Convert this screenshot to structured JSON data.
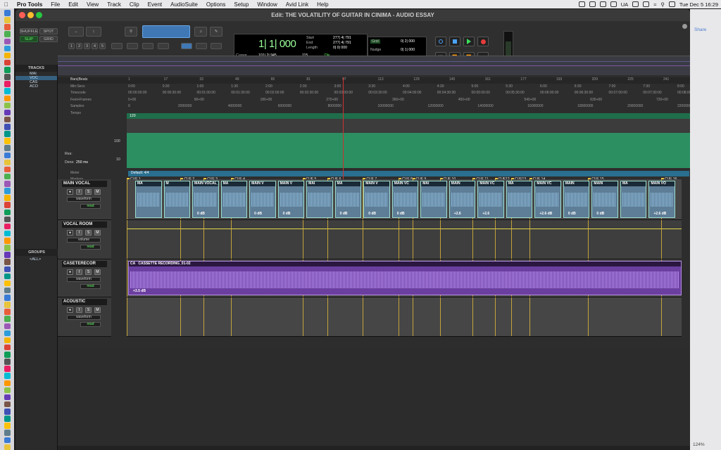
{
  "menubar": {
    "app": "Pro Tools",
    "items": [
      "File",
      "Edit",
      "View",
      "Track",
      "Clip",
      "Event",
      "AudioSuite",
      "Options",
      "Setup",
      "Window",
      "Avid Link",
      "Help"
    ],
    "right": {
      "lang": "UA",
      "datetime": "Tue Dec 5  16:29"
    }
  },
  "window": {
    "title": "Edit: THE VOLATILITY OF GUITAR IN CINIMA - AUDIO ESSAY"
  },
  "toolbar": {
    "modes": {
      "shuffle": "SHUFFLE",
      "spot": "SPOT",
      "slip": "SLIP",
      "grid": "GRID"
    },
    "zoom_presets": [
      "1",
      "2",
      "3",
      "4",
      "5"
    ],
    "counter": {
      "main": "1| 1| 000",
      "start_label": "Start",
      "end_label": "End",
      "length_label": "Length",
      "start": "277| 4| 791",
      "end": "277| 4| 791",
      "length": "0| 0| 000",
      "cursor_label": "Cursor",
      "cursor": "101| 2| 945",
      "tempo": "115",
      "dly": "Dly"
    },
    "grid": {
      "grid_label": "Grid",
      "grid_value": "0| 2| 000",
      "nudge_label": "Nudge",
      "nudge_value": "0| 1| 000"
    }
  },
  "left_panel": {
    "tracks_header": "TRACKS",
    "track_items": [
      "MAI",
      "VOC",
      "CAS",
      "ACO"
    ],
    "groups_header": "GROUPS",
    "groups_item": "<ALL>"
  },
  "rulers": {
    "names": [
      "Bars|Beats",
      "Min:Secs",
      "Timecode",
      "Feet+Frames",
      "Samples",
      "Tempo",
      "Meter",
      "Markers"
    ],
    "bars": [
      "1",
      "17",
      "33",
      "49",
      "65",
      "81",
      "97",
      "113",
      "129",
      "145",
      "161",
      "177",
      "193",
      "209",
      "225",
      "241"
    ],
    "minsecs": [
      "0:00",
      "0:30",
      "1:00",
      "1:30",
      "2:00",
      "2:30",
      "3:00",
      "3:30",
      "4:00",
      "4:30",
      "5:00",
      "5:30",
      "6:00",
      "6:30",
      "7:00",
      "7:30",
      "8:00"
    ],
    "timecode": [
      "00:00:00:00",
      "00:00:30:00",
      "00:01:00:00",
      "00:01:30:00",
      "00:02:00:00",
      "00:02:30:00",
      "00:03:00:00",
      "00:03:30:00",
      "00:04:00:00",
      "00:04:30:00",
      "00:05:00:00",
      "00:05:30:00",
      "00:06:00:00",
      "00:06:30:00",
      "00:07:00:00",
      "00:07:30:00",
      "00:08:00:00"
    ],
    "feet": [
      "0+00",
      "90+00",
      "180+00",
      "270+00",
      "360+00",
      "450+00",
      "540+00",
      "630+00",
      "720+00"
    ],
    "samples": [
      "0",
      "2000000",
      "4000000",
      "6000000",
      "8000000",
      "10000000",
      "12000000",
      "14000000",
      "16000000",
      "18000000",
      "20000000",
      "22000000"
    ],
    "tempo_value": "120",
    "tempo_axis": [
      "100",
      "10"
    ],
    "res_label": "Res:",
    "dens_label": "Dens:",
    "dens_value": "250 ms",
    "meter": "Default: 4/4",
    "markers": [
      "CUE 1",
      "CUE 2",
      "CUE 3",
      "CUE 4",
      "CUE 5",
      "CUE 6",
      "CUE 7",
      "CUE 8",
      "CUE 9",
      "CUE 10",
      "CUE 11",
      "CUE12",
      "CUE13",
      "CUE 14",
      "CUE 15",
      "CUE 16"
    ]
  },
  "tracks": [
    {
      "name": "MAIN VOCAL",
      "view": "waveform",
      "mode": "read",
      "clips": [
        {
          "title": "MA",
          "gain": ""
        },
        {
          "title": "M",
          "gain": ""
        },
        {
          "title": "MAIN VOCAL_06-04",
          "gain": "0 dB"
        },
        {
          "title": "MA",
          "gain": ""
        },
        {
          "title": "MAIN V",
          "gain": "0 dB"
        },
        {
          "title": "MAIN V",
          "gain": "0 dB"
        },
        {
          "title": "MAI",
          "gain": ""
        },
        {
          "title": "MA",
          "gain": "0 dB"
        },
        {
          "title": "MAIN V",
          "gain": "0 dB"
        },
        {
          "title": "MAIN VC",
          "gain": "0 dB"
        },
        {
          "title": "MAI",
          "gain": ""
        },
        {
          "title": "MAIN",
          "gain": "+2.6"
        },
        {
          "title": "MAIN VC",
          "gain": "+2.6"
        },
        {
          "title": "MA",
          "gain": ""
        },
        {
          "title": "MAIN VC",
          "gain": "+2.6 dB"
        },
        {
          "title": "MAIN",
          "gain": "0 dB"
        },
        {
          "title": "MAIN",
          "gain": "0 dB"
        },
        {
          "title": "MA",
          "gain": ""
        },
        {
          "title": "MAIN VO",
          "gain": "+2.6 dB"
        }
      ]
    },
    {
      "name": "VOCAL ROOM",
      "view": "volume",
      "mode": "read",
      "clips": []
    },
    {
      "name": "CASETERECOR",
      "view": "waveform",
      "mode": "read",
      "clips": [
        {
          "title": "CASSETTE RECORDING_01-02",
          "gain": "+3.5 dB",
          "pre": "CA"
        }
      ]
    },
    {
      "name": "ACOUSTIC",
      "view": "waveform",
      "mode": "read",
      "clips": []
    }
  ],
  "sidepanel": {
    "share": "Share",
    "zoom": "124%"
  },
  "colors": {
    "audio_clip": "#5e7d96",
    "cassette_clip": "#6b3fa0",
    "tempo_area": "#2c8f62",
    "marker": "#e8c442"
  }
}
